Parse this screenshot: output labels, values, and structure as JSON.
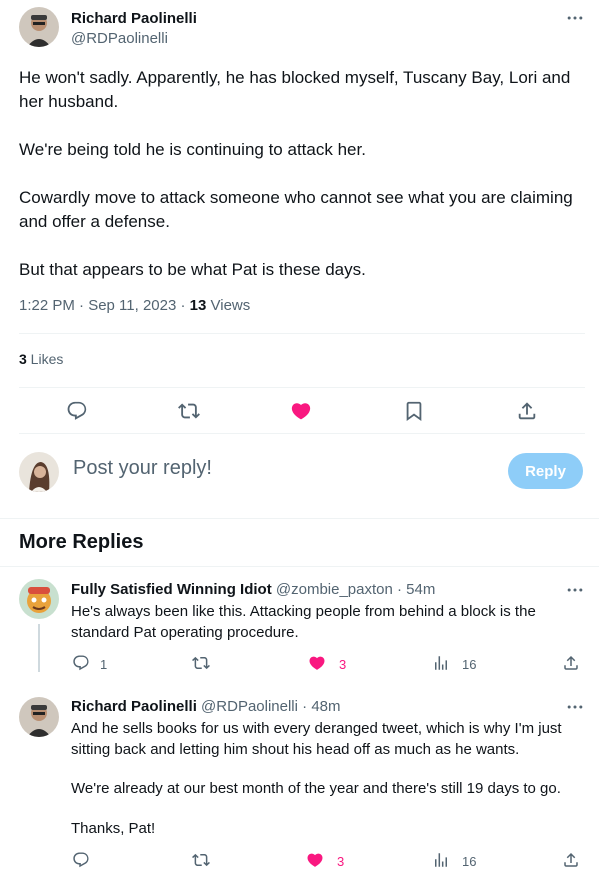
{
  "main_tweet": {
    "author_name": "Richard Paolinelli",
    "author_handle": "@RDPaolinelli",
    "paragraphs": [
      "He won't sadly. Apparently, he has blocked myself, Tuscany Bay, Lori and her husband.",
      "We're being told he is continuing to attack her.",
      "Cowardly move to attack someone who cannot see what you are claiming and offer a defense.",
      "But that appears to be what Pat is these days."
    ],
    "timestamp": "1:22 PM · Sep 11, 2023 · ",
    "views_count": "13",
    "views_label": " Views",
    "likes_count": "3",
    "likes_label": " Likes"
  },
  "composer": {
    "placeholder": "Post your reply!",
    "reply_button": "Reply"
  },
  "more_replies": {
    "title": "More Replies",
    "items": [
      {
        "author_name": "Fully Satisfied Winning Idiot",
        "author_handle": "@zombie_paxton",
        "time": " · 54m",
        "paragraphs": [
          "He's always been like this. Attacking people from behind a block is the standard Pat operating procedure."
        ],
        "replies": "1",
        "retweets": "",
        "likes": "3",
        "views": "16"
      },
      {
        "author_name": "Richard Paolinelli",
        "author_handle": "@RDPaolinelli",
        "time": " · 48m",
        "paragraphs": [
          "And he sells books for us with every deranged tweet, which is why I'm just sitting back and letting him shout his head off as much as he wants.",
          "We're already at our best month of the year and there's still 19 days to go.",
          "Thanks, Pat!"
        ],
        "replies": "",
        "retweets": "",
        "likes": "3",
        "views": "16"
      }
    ]
  },
  "colors": {
    "text": "#0f1419",
    "secondary": "#536471",
    "like_pink": "#f91880",
    "reply_button_disabled": "#8ecdf8",
    "divider": "#eff3f4"
  },
  "icons": [
    "more-icon",
    "reply-icon",
    "retweet-icon",
    "heart-filled-icon",
    "bookmark-icon",
    "share-icon",
    "views-icon"
  ]
}
